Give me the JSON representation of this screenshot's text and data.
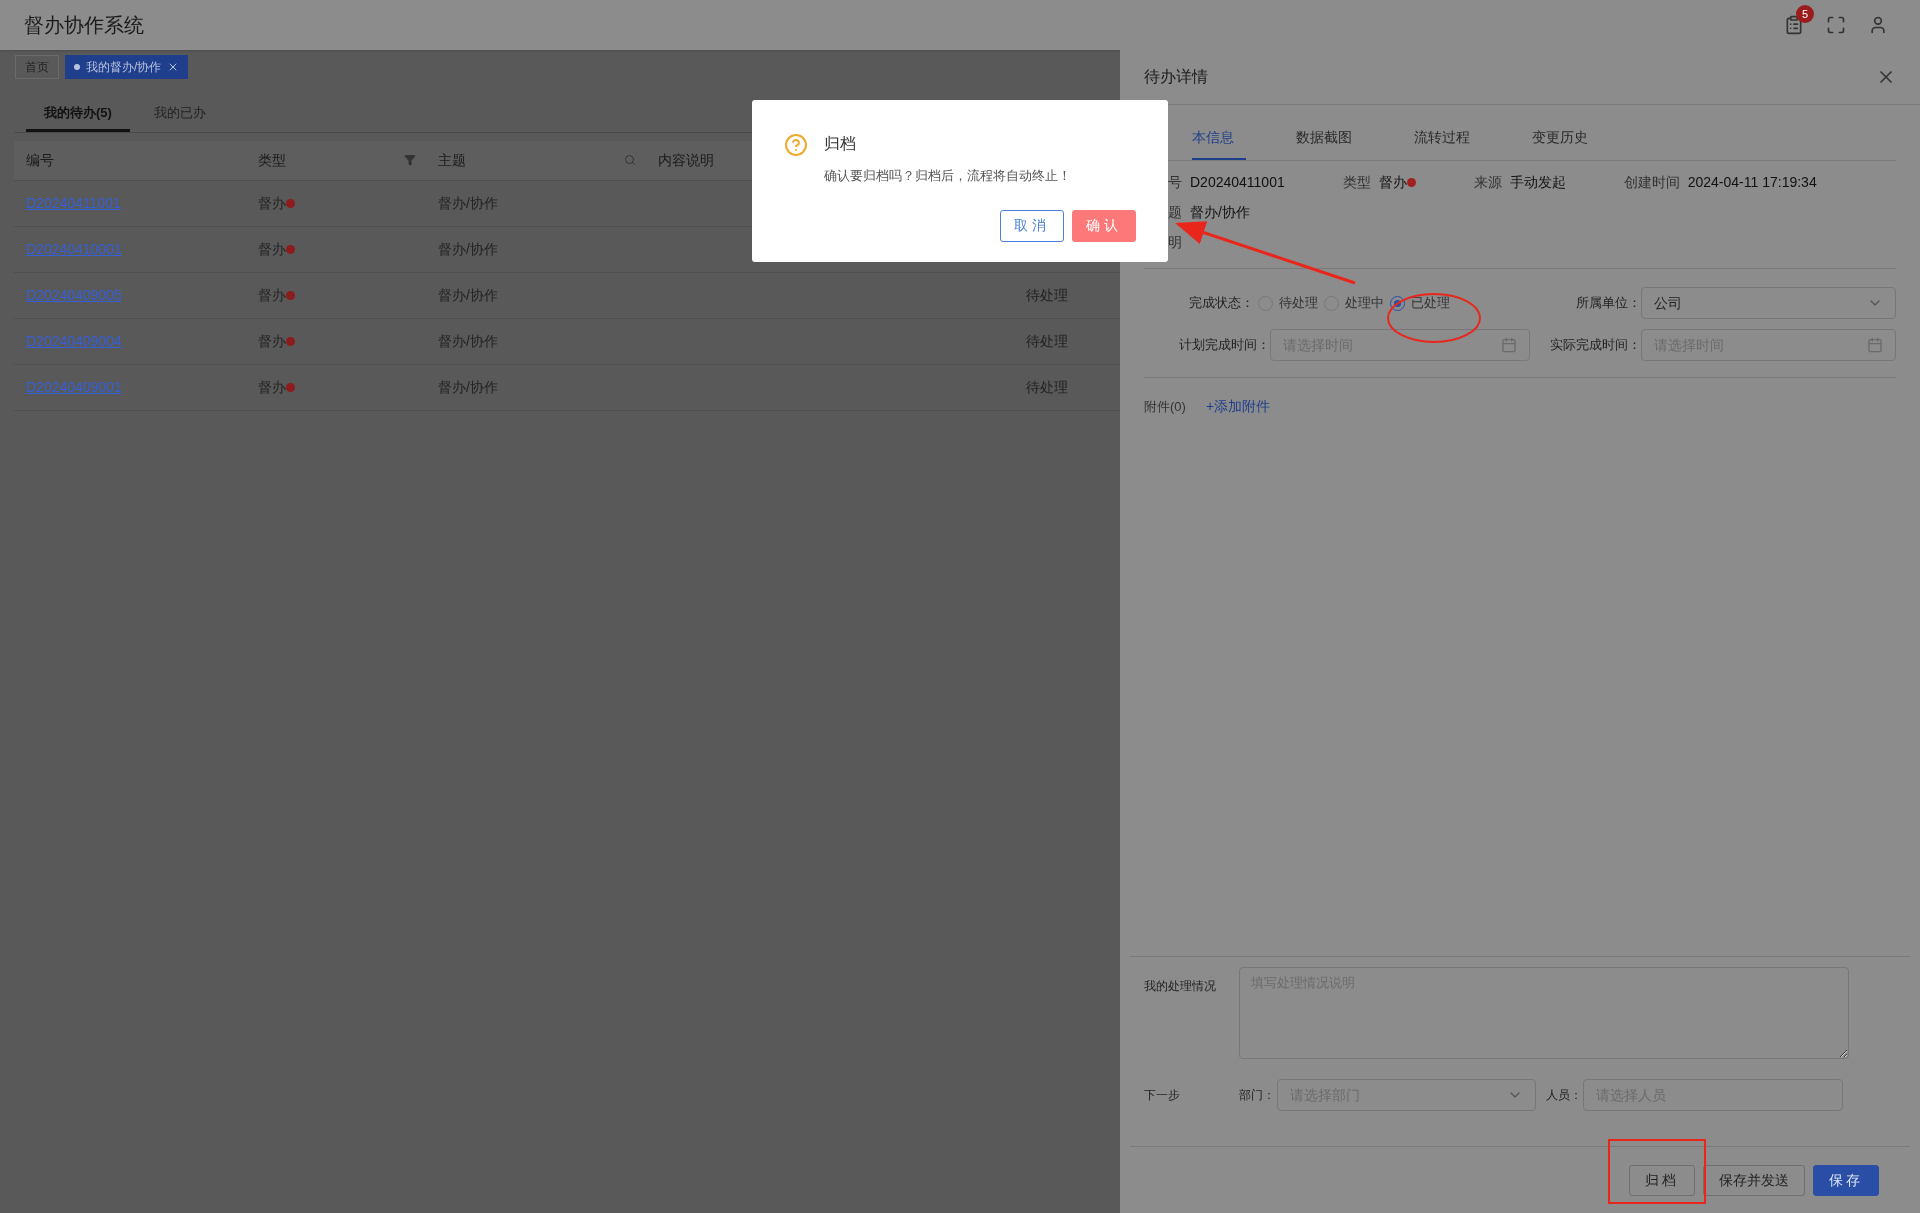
{
  "app": {
    "title": "督办协作系统",
    "notification_count": "5"
  },
  "page_tabs": [
    {
      "label": "首页",
      "selected": false,
      "closable": false
    },
    {
      "label": "我的督办/协作",
      "selected": true,
      "closable": true
    }
  ],
  "list_tabs": [
    {
      "label": "我的待办(5)",
      "selected": true
    },
    {
      "label": "我的已办",
      "selected": false
    }
  ],
  "table": {
    "columns": [
      {
        "label": "编号",
        "filterable": false,
        "searchable": false
      },
      {
        "label": "类型",
        "filterable": true,
        "searchable": false
      },
      {
        "label": "主题",
        "filterable": false,
        "searchable": true
      },
      {
        "label": "内容说明"
      }
    ],
    "rows": [
      {
        "number": "D20240411001",
        "type": "督办",
        "subject": "督办/协作"
      },
      {
        "number": "D20240410001",
        "type": "督办",
        "subject": "督办/协作"
      },
      {
        "number": "D20240409005",
        "type": "督办",
        "subject": "督办/协作",
        "status": "待处理"
      },
      {
        "number": "D20240409004",
        "type": "督办",
        "subject": "督办/协作",
        "status": "待处理"
      },
      {
        "number": "D20240409001",
        "type": "督办",
        "subject": "督办/协作",
        "status": "待处理"
      }
    ]
  },
  "drawer": {
    "title": "待办详情",
    "tabs": [
      {
        "label": "本信息",
        "selected": true
      },
      {
        "label": "数据截图",
        "selected": false
      },
      {
        "label": "流转过程",
        "selected": false
      },
      {
        "label": "变更历史",
        "selected": false
      }
    ],
    "info_rows": [
      [
        {
          "label": "号",
          "value": "D20240411001",
          "kind": "text"
        },
        {
          "label": "类型",
          "value": "督办",
          "kind": "type"
        },
        {
          "label": "来源",
          "value": "手动发起",
          "kind": "text"
        },
        {
          "label": "创建时间",
          "value": "2024-04-11 17:19:34",
          "kind": "text"
        }
      ],
      [
        {
          "label": "题",
          "value": "督办/协作",
          "kind": "text"
        }
      ],
      [
        {
          "label": "明",
          "kind": "text"
        }
      ]
    ],
    "status_label": "完成状态：",
    "status_options": [
      {
        "label": "待处理",
        "selected": false
      },
      {
        "label": "处理中",
        "selected": false
      },
      {
        "label": "已处理",
        "selected": true
      }
    ],
    "unit_label": "所属单位：",
    "unit_value": "公司",
    "plan_label": "计划完成时间：",
    "plan_placeholder": "请选择时间",
    "actual_label": "实际完成时间：",
    "actual_placeholder": "请选择时间",
    "attachments_label": "附件(0)",
    "add_attachment": "+添加附件",
    "handling_label": "我的处理情况",
    "handling_placeholder": "填写处理情况说明",
    "next_label": "下一步",
    "dept_label": "部门：",
    "dept_placeholder": "请选择部门",
    "person_label": "人员：",
    "person_placeholder": "请选择人员",
    "buttons": [
      {
        "label": "归档",
        "kind": "default"
      },
      {
        "label": "保存并发送",
        "kind": "default"
      },
      {
        "label": "保存",
        "kind": "primary"
      }
    ]
  },
  "modal": {
    "title": "归档",
    "message": "确认要归档吗？归档后，流程将自动终止！",
    "buttons": [
      {
        "label": "取消",
        "kind": "default"
      },
      {
        "label": "确认",
        "kind": "danger"
      }
    ]
  }
}
